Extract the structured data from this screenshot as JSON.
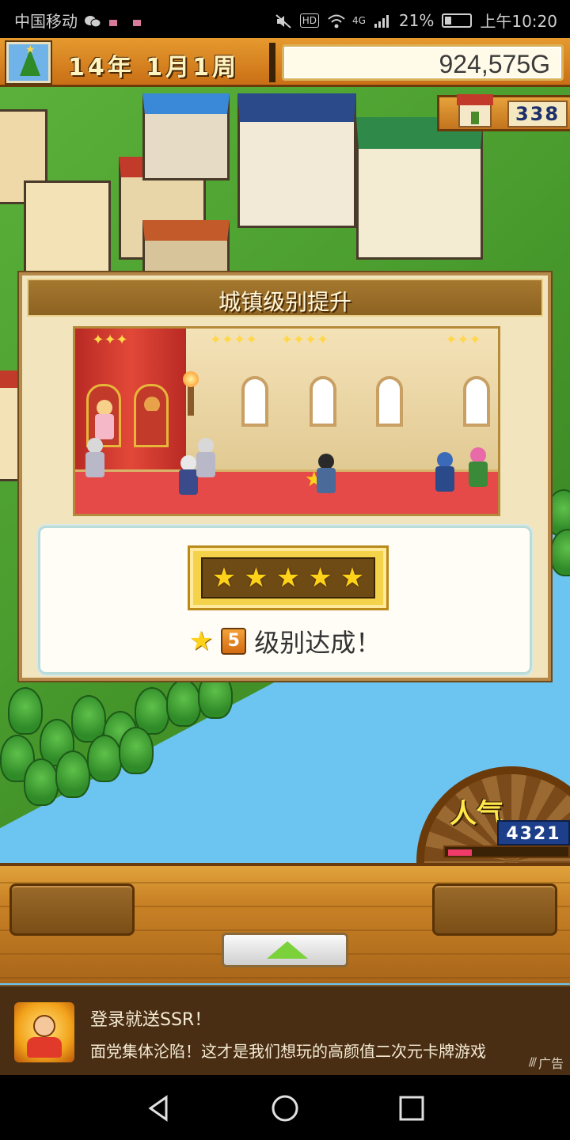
{
  "status_bar": {
    "carrier": "中国移动",
    "network": "4G",
    "battery": "21%",
    "time": "上午10:20",
    "hd_label": "HD"
  },
  "hud": {
    "date": "14年 1月1周",
    "money": "924,575G",
    "town_count": "338"
  },
  "dialog": {
    "title": "城镇级别提升",
    "stars": 5,
    "level_number": "5",
    "achievement_text": "级别达成！"
  },
  "popularity": {
    "label": "人气",
    "value": "4321",
    "bar_fraction": 0.2
  },
  "ad": {
    "title": "登录就送SSR！",
    "description": "面党集体沦陷！这才是我们想玩的高颜值二次元卡牌游戏",
    "tag": "广告"
  },
  "colors": {
    "hud_orange": "#e69a2e",
    "dialog_bg": "#f2e5bd",
    "star_gold": "#ffd21a",
    "sky": "#6cc4f0",
    "grass": "#4a9d2e"
  }
}
